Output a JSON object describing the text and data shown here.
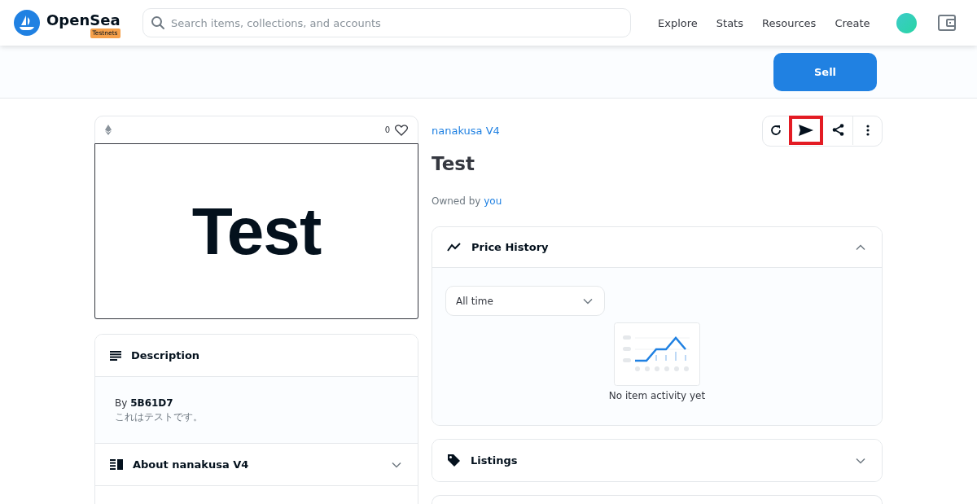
{
  "header": {
    "logo_text": "OpenSea",
    "network_badge": "Testnets",
    "search": {
      "placeholder": "Search items, collections, and accounts"
    },
    "nav": [
      "Explore",
      "Stats",
      "Resources",
      "Create"
    ]
  },
  "sell_button": "Sell",
  "asset_card": {
    "like_count": "0",
    "image_text": "Test"
  },
  "description": {
    "title": "Description",
    "by_label": "By",
    "creator": "5B61D7",
    "text": "これはテストです。"
  },
  "about": {
    "title": "About nanakusa V4",
    "expanded": false
  },
  "collection": "nanakusa V4",
  "title": "Test",
  "owner": {
    "label": "Owned by",
    "name": "you"
  },
  "actions": [
    {
      "kind": "refresh",
      "highlighted": false
    },
    {
      "kind": "send",
      "highlighted": true
    },
    {
      "kind": "share",
      "highlighted": false
    },
    {
      "kind": "more",
      "highlighted": false
    }
  ],
  "price_history": {
    "title": "Price History",
    "expanded": true,
    "range": "All time",
    "empty_text": "No item activity yet"
  },
  "listings": {
    "title": "Listings",
    "expanded": false
  }
}
